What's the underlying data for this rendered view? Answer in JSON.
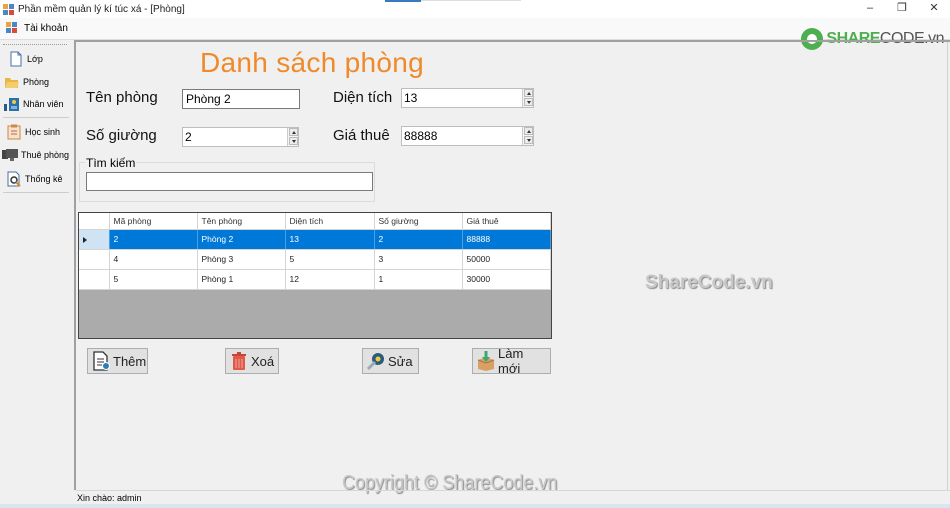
{
  "window": {
    "title": "Phần mềm quản lý kí túc xá - [Phòng]",
    "controls": {
      "minimize": "–",
      "restore": "❐",
      "close": "✕"
    }
  },
  "menubar": {
    "items": [
      {
        "label": "Tài khoản",
        "icon": "app-icon"
      }
    ]
  },
  "logo": {
    "part1": "SHARE",
    "part2": "CODE.vn"
  },
  "sidebar": {
    "items": [
      {
        "label": "Lớp",
        "icon": "document-icon"
      },
      {
        "label": "Phòng",
        "icon": "folder-icon"
      },
      {
        "label": "Nhân viên",
        "icon": "staff-icon"
      },
      {
        "label": "Học sinh",
        "icon": "clipboard-icon"
      },
      {
        "label": "Thuê phòng",
        "icon": "monitor-icon"
      },
      {
        "label": "Thống kê",
        "icon": "report-search-icon"
      }
    ]
  },
  "form": {
    "heading": "Danh sách phòng",
    "ten_phong_label": "Tên phòng",
    "ten_phong_value": "Phòng 2",
    "so_giuong_label": "Số giường",
    "so_giuong_value": "2",
    "dien_tich_label": "Diện tích",
    "dien_tich_value": "13",
    "gia_thue_label": "Giá thuê",
    "gia_thue_value": "88888",
    "search_group_label": "Tìm kiếm",
    "search_value": ""
  },
  "grid": {
    "columns": [
      "Mã phòng",
      "Tên phòng",
      "Diện tích",
      "Số giường",
      "Giá thuê"
    ],
    "rows": [
      {
        "ma": "2",
        "ten": "Phòng 2",
        "dientich": "13",
        "giuong": "2",
        "gia": "88888",
        "selected": true
      },
      {
        "ma": "4",
        "ten": "Phòng 3",
        "dientich": "5",
        "giuong": "3",
        "gia": "50000",
        "selected": false
      },
      {
        "ma": "5",
        "ten": "Phòng 1",
        "dientich": "12",
        "giuong": "1",
        "gia": "30000",
        "selected": false
      }
    ]
  },
  "buttons": {
    "add": "Thêm",
    "delete": "Xoá",
    "edit": "Sửa",
    "refresh": "Làm mới"
  },
  "watermarks": {
    "center": "ShareCode.vn",
    "copyright": "Copyright © ShareCode.vn"
  },
  "status": {
    "text": "Xin chào: admin"
  },
  "colors": {
    "heading": "#f0892a",
    "selection": "#0078d7"
  }
}
